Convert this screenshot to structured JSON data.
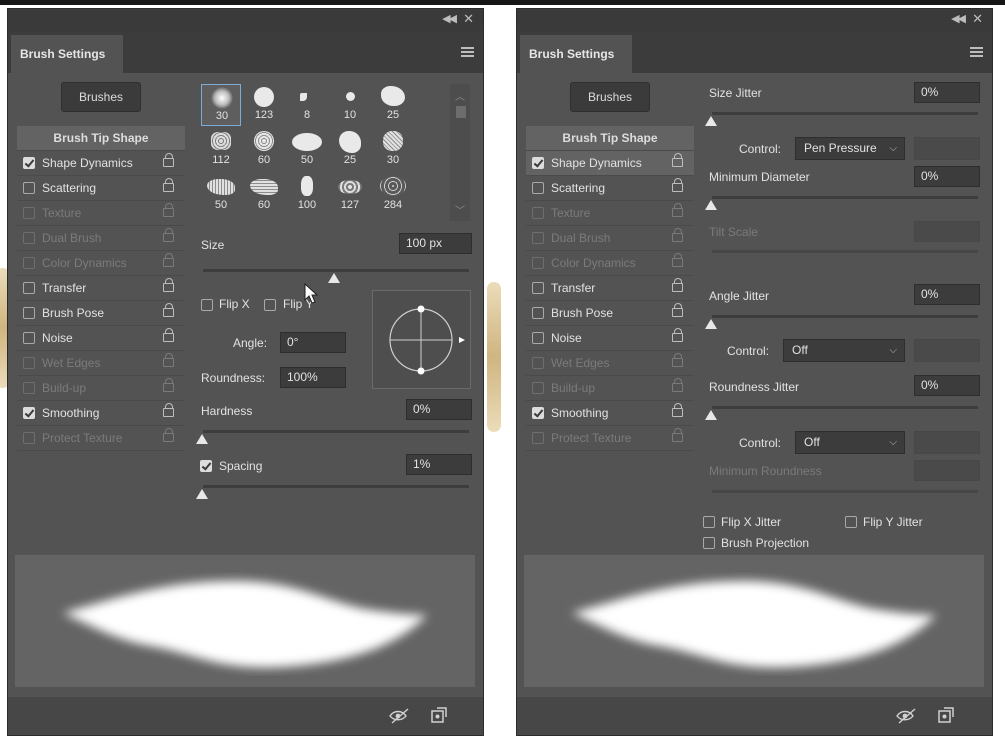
{
  "left_panel": {
    "title": "Brush Settings",
    "brushes_button": "Brushes",
    "options": [
      {
        "label": "Brush Tip Shape",
        "header": true
      },
      {
        "label": "Shape Dynamics",
        "checked": true,
        "enabled": true
      },
      {
        "label": "Scattering",
        "checked": false,
        "enabled": true
      },
      {
        "label": "Texture",
        "checked": false,
        "enabled": false
      },
      {
        "label": "Dual Brush",
        "checked": false,
        "enabled": false
      },
      {
        "label": "Color Dynamics",
        "checked": false,
        "enabled": false
      },
      {
        "label": "Transfer",
        "checked": false,
        "enabled": true
      },
      {
        "label": "Brush Pose",
        "checked": false,
        "enabled": true
      },
      {
        "label": "Noise",
        "checked": false,
        "enabled": true
      },
      {
        "label": "Wet Edges",
        "checked": false,
        "enabled": false
      },
      {
        "label": "Build-up",
        "checked": false,
        "enabled": false
      },
      {
        "label": "Smoothing",
        "checked": true,
        "enabled": true
      },
      {
        "label": "Protect Texture",
        "checked": false,
        "enabled": false
      }
    ],
    "brush_grid": {
      "sizes": [
        "30",
        "123",
        "8",
        "10",
        "25",
        "112",
        "60",
        "50",
        "25",
        "30",
        "50",
        "60",
        "100",
        "127",
        "284"
      ],
      "selected": "30"
    },
    "size": {
      "label": "Size",
      "value": "100 px",
      "slider_fraction": 0.49
    },
    "flip_x": {
      "label": "Flip X",
      "checked": false
    },
    "flip_y": {
      "label": "Flip Y",
      "checked": false
    },
    "angle": {
      "label": "Angle:",
      "value": "0°"
    },
    "roundness": {
      "label": "Roundness:",
      "value": "100%"
    },
    "hardness": {
      "label": "Hardness",
      "value": "0%",
      "slider_fraction": 0
    },
    "spacing": {
      "label": "Spacing",
      "value": "1%",
      "checked": true,
      "slider_fraction": 0
    }
  },
  "right_panel": {
    "title": "Brush Settings",
    "brushes_button": "Brushes",
    "options": [
      {
        "label": "Brush Tip Shape",
        "header": true
      },
      {
        "label": "Shape Dynamics",
        "checked": true,
        "enabled": true,
        "selected": true
      },
      {
        "label": "Scattering",
        "checked": false,
        "enabled": true
      },
      {
        "label": "Texture",
        "checked": false,
        "enabled": false
      },
      {
        "label": "Dual Brush",
        "checked": false,
        "enabled": false
      },
      {
        "label": "Color Dynamics",
        "checked": false,
        "enabled": false
      },
      {
        "label": "Transfer",
        "checked": false,
        "enabled": true
      },
      {
        "label": "Brush Pose",
        "checked": false,
        "enabled": true
      },
      {
        "label": "Noise",
        "checked": false,
        "enabled": true
      },
      {
        "label": "Wet Edges",
        "checked": false,
        "enabled": false
      },
      {
        "label": "Build-up",
        "checked": false,
        "enabled": false
      },
      {
        "label": "Smoothing",
        "checked": true,
        "enabled": true
      },
      {
        "label": "Protect Texture",
        "checked": false,
        "enabled": false
      }
    ],
    "size_jitter": {
      "label": "Size Jitter",
      "value": "0%"
    },
    "size_control": {
      "label": "Control:",
      "value": "Pen Pressure"
    },
    "minimum_diameter": {
      "label": "Minimum Diameter",
      "value": "0%"
    },
    "tilt_scale": {
      "label": "Tilt Scale"
    },
    "angle_jitter": {
      "label": "Angle Jitter",
      "value": "0%"
    },
    "angle_control": {
      "label": "Control:",
      "value": "Off"
    },
    "roundness_jitter": {
      "label": "Roundness Jitter",
      "value": "0%"
    },
    "roundness_control": {
      "label": "Control:",
      "value": "Off"
    },
    "minimum_roundness": {
      "label": "Minimum Roundness"
    },
    "flip_x_jitter": {
      "label": "Flip X Jitter",
      "checked": false
    },
    "flip_y_jitter": {
      "label": "Flip Y Jitter",
      "checked": false
    },
    "brush_projection": {
      "label": "Brush Projection",
      "checked": false
    }
  },
  "icons": {
    "collapse": "double-chevron-icon",
    "close": "close-icon",
    "panel_menu": "hamburger-menu-icon",
    "lock": "lock-icon",
    "visibility": "eye-toggle-icon",
    "new_preset": "new-brush-preset-icon"
  }
}
